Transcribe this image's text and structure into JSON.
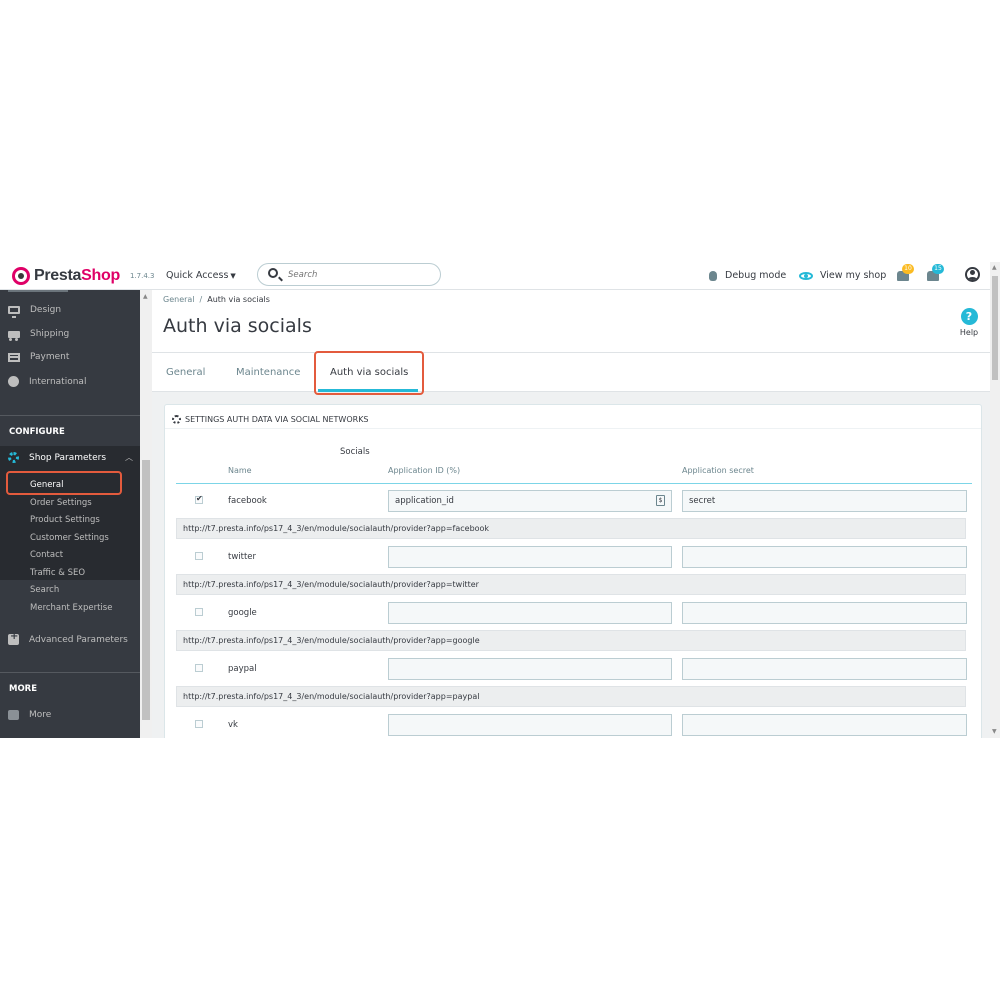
{
  "header": {
    "logo_prefix": "Presta",
    "logo_suffix": "Shop",
    "version": "1.7.4.3",
    "quick_access": "Quick Access",
    "search_placeholder": "Search",
    "debug_mode": "Debug mode",
    "view_shop": "View my shop",
    "orders_badge": "10",
    "customers_badge": "15"
  },
  "sidebar": {
    "items": [
      {
        "label": "Design",
        "icon": "monitor-icon"
      },
      {
        "label": "Shipping",
        "icon": "truck-icon"
      },
      {
        "label": "Payment",
        "icon": "credit-card-icon"
      },
      {
        "label": "International",
        "icon": "globe-icon"
      }
    ],
    "configure_heading": "CONFIGURE",
    "shop_parameters": "Shop Parameters",
    "sub_items": [
      "General",
      "Order Settings",
      "Product Settings",
      "Customer Settings",
      "Contact",
      "Traffic & SEO",
      "Search",
      "Merchant Expertise"
    ],
    "advanced_parameters": "Advanced Parameters",
    "more_heading": "MORE",
    "more_item": "More"
  },
  "breadcrumb": {
    "parent": "General",
    "separator": "/",
    "current": "Auth via socials"
  },
  "page_title": "Auth via socials",
  "help_label": "Help",
  "tabs": [
    "General",
    "Maintenance",
    "Auth via socials"
  ],
  "panel": {
    "heading": "SETTINGS AUTH DATA VIA SOCIAL NETWORKS",
    "socials_label": "Socials",
    "columns": {
      "name": "Name",
      "app_id": "Application ID (%)",
      "secret": "Application secret"
    },
    "rows": [
      {
        "name": "facebook",
        "checked": true,
        "app_id": "application_id",
        "secret": "secret",
        "url": "http://t7.presta.info/ps17_4_3/en/module/socialauth/provider?app=facebook"
      },
      {
        "name": "twitter",
        "checked": false,
        "app_id": "",
        "secret": "",
        "url": "http://t7.presta.info/ps17_4_3/en/module/socialauth/provider?app=twitter"
      },
      {
        "name": "google",
        "checked": false,
        "app_id": "",
        "secret": "",
        "url": "http://t7.presta.info/ps17_4_3/en/module/socialauth/provider?app=google"
      },
      {
        "name": "paypal",
        "checked": false,
        "app_id": "",
        "secret": "",
        "url": "http://t7.presta.info/ps17_4_3/en/module/socialauth/provider?app=paypal"
      },
      {
        "name": "vk",
        "checked": false,
        "app_id": "",
        "secret": "",
        "url": ""
      }
    ],
    "lang_marker": "$"
  },
  "colors": {
    "accent": "#25b9d7",
    "brand": "#df0067",
    "highlight": "#e35b3d",
    "sidebar": "#363a41"
  }
}
